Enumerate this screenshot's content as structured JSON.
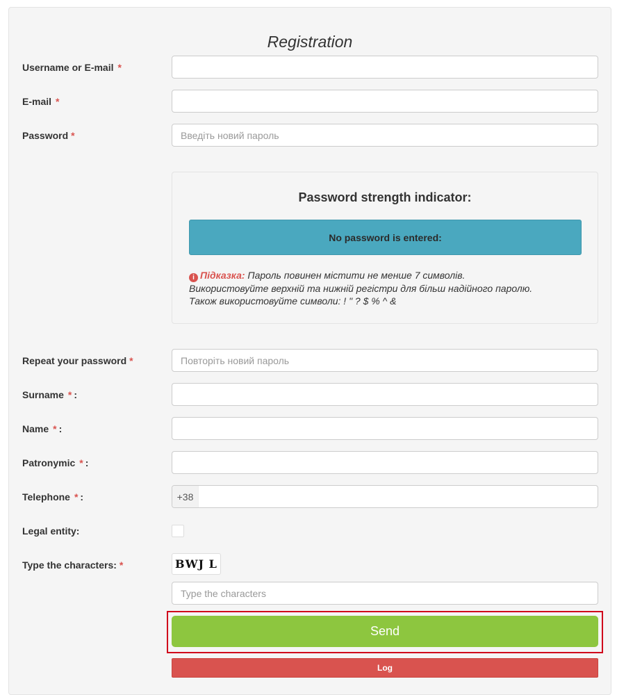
{
  "form": {
    "title": "Registration",
    "colors": {
      "required": "#d9534f",
      "send": "#8dc63f",
      "log": "#d9534f",
      "strength_bar": "#4aa8bf"
    },
    "fields": {
      "username": {
        "label": "Username or E-mail",
        "value": "",
        "placeholder": ""
      },
      "email": {
        "label": "E-mail",
        "value": "",
        "placeholder": ""
      },
      "password": {
        "label": "Password",
        "value": "",
        "placeholder": "Введіть новий пароль"
      },
      "repeat_password": {
        "label": "Repeat your password",
        "value": "",
        "placeholder": "Повторіть новий пароль"
      },
      "surname": {
        "label": "Surname",
        "value": "",
        "placeholder": ""
      },
      "name": {
        "label": "Name",
        "value": "",
        "placeholder": ""
      },
      "patronymic": {
        "label": "Patronymic",
        "value": "",
        "placeholder": ""
      },
      "telephone": {
        "label": "Telephone",
        "prefix": "+38",
        "value": ""
      },
      "legal_entity": {
        "label": "Legal entity:",
        "checked": false
      },
      "captcha": {
        "label": "Type the characters:",
        "image_text": "BWJ L",
        "placeholder": "Type the characters"
      }
    },
    "required_mark": "*",
    "colon": ":",
    "strength": {
      "title": "Password strength indicator:",
      "status": "No password is entered:",
      "hint_icon": "info-icon",
      "hint_label": "Підказка:",
      "hint_line1": "Пароль повинен містити не менше 7 символів.",
      "hint_line2": "Використовуйте верхній та нижній регістри для більш надійного паролю.",
      "hint_line3": "Також використовуйте символи: ! \" ? $ % ^ &"
    },
    "buttons": {
      "send": "Send",
      "log": "Log"
    }
  }
}
